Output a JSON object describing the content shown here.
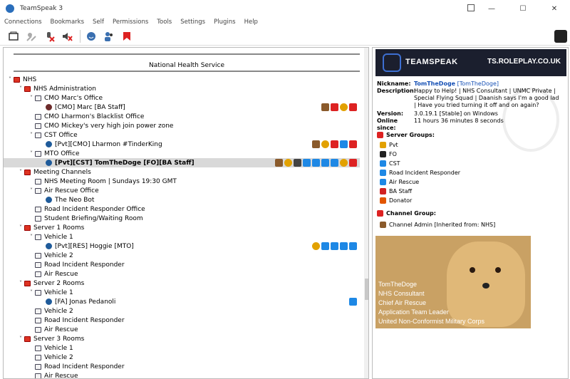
{
  "window": {
    "title": "TeamSpeak 3"
  },
  "menu": [
    "Connections",
    "Bookmarks",
    "Self",
    "Permissions",
    "Tools",
    "Settings",
    "Plugins",
    "Help"
  ],
  "toolbar": {
    "icons": [
      "connect-icon",
      "disconnect-icon",
      "mute-mic-icon",
      "mute-speaker-icon",
      "away-icon",
      "contacts-icon",
      "bookmarks-icon"
    ]
  },
  "tree": {
    "header": "National Health Service",
    "rows": [
      {
        "indent": 0,
        "arrow": "v",
        "type": "server",
        "label": "NHS"
      },
      {
        "indent": 1,
        "arrow": "v",
        "type": "channel-red",
        "label": "NHS Administration"
      },
      {
        "indent": 2,
        "arrow": "v",
        "type": "channel",
        "label": "CMO Marc's Office"
      },
      {
        "indent": 3,
        "arrow": "",
        "type": "user-muted",
        "label": "[CMO] Marc [BA Staff]",
        "badges": [
          "brown",
          "red",
          "gold",
          "red"
        ]
      },
      {
        "indent": 2,
        "arrow": "",
        "type": "channel",
        "label": "CMO Lharmon's Blacklist Office"
      },
      {
        "indent": 2,
        "arrow": "",
        "type": "channel",
        "label": "CMO Mickey's very high join power zone"
      },
      {
        "indent": 2,
        "arrow": "v",
        "type": "channel",
        "label": "CST Office"
      },
      {
        "indent": 3,
        "arrow": "",
        "type": "user",
        "label": "[Pvt][CMO] Lharmon #TinderKing",
        "badges": [
          "brown",
          "gold",
          "red",
          "blue",
          "red"
        ]
      },
      {
        "indent": 2,
        "arrow": "v",
        "type": "channel",
        "label": "MTO Office"
      },
      {
        "indent": 3,
        "arrow": "",
        "type": "user",
        "label": "[Pvt][CST] TomTheDoge [FO][BA Staff]",
        "selected": true,
        "badges": [
          "brown",
          "gold",
          "dark",
          "blue",
          "blue",
          "blue",
          "blue",
          "gold",
          "red"
        ]
      },
      {
        "indent": 1,
        "arrow": "v",
        "type": "channel-red",
        "label": "Meeting Channels"
      },
      {
        "indent": 2,
        "arrow": "",
        "type": "channel",
        "label": "NHS Meeting Room | Sundays 19:30 GMT"
      },
      {
        "indent": 2,
        "arrow": "v",
        "type": "channel",
        "label": "Air Rescue Office"
      },
      {
        "indent": 3,
        "arrow": "",
        "type": "user",
        "label": "The Neo Bot"
      },
      {
        "indent": 2,
        "arrow": "",
        "type": "channel",
        "label": "Road Incident Responder Office"
      },
      {
        "indent": 2,
        "arrow": "",
        "type": "channel",
        "label": "Student Briefing/Waiting Room"
      },
      {
        "indent": 1,
        "arrow": "v",
        "type": "channel-red",
        "label": "Server 1 Rooms"
      },
      {
        "indent": 2,
        "arrow": "v",
        "type": "channel",
        "label": "Vehicle 1"
      },
      {
        "indent": 3,
        "arrow": "",
        "type": "user",
        "label": "[Pvt][RES] Hoggie [MTO]",
        "badges": [
          "gold",
          "blue",
          "blue",
          "blue",
          "blue"
        ]
      },
      {
        "indent": 2,
        "arrow": "",
        "type": "channel",
        "label": "Vehicle 2"
      },
      {
        "indent": 2,
        "arrow": "",
        "type": "channel",
        "label": "Road Incident Responder"
      },
      {
        "indent": 2,
        "arrow": "",
        "type": "channel",
        "label": "Air Rescue"
      },
      {
        "indent": 1,
        "arrow": "v",
        "type": "channel-red",
        "label": "Server 2 Rooms"
      },
      {
        "indent": 2,
        "arrow": "v",
        "type": "channel",
        "label": "Vehicle 1"
      },
      {
        "indent": 3,
        "arrow": "",
        "type": "user",
        "label": "[FA] Jonas Pedanoli",
        "badges": [
          "blue"
        ]
      },
      {
        "indent": 2,
        "arrow": "",
        "type": "channel",
        "label": "Vehicle 2"
      },
      {
        "indent": 2,
        "arrow": "",
        "type": "channel",
        "label": "Road Incident Responder"
      },
      {
        "indent": 2,
        "arrow": "",
        "type": "channel",
        "label": "Air Rescue"
      },
      {
        "indent": 1,
        "arrow": "v",
        "type": "channel-red",
        "label": "Server 3 Rooms"
      },
      {
        "indent": 2,
        "arrow": "",
        "type": "channel",
        "label": "Vehicle 1"
      },
      {
        "indent": 2,
        "arrow": "",
        "type": "channel",
        "label": "Vehicle 2"
      },
      {
        "indent": 2,
        "arrow": "",
        "type": "channel",
        "label": "Road Incident Responder"
      },
      {
        "indent": 2,
        "arrow": "",
        "type": "channel",
        "label": "Air Rescue"
      }
    ]
  },
  "banner": {
    "brand": "TEAMSPEAK",
    "host": "TS.ROLEPLAY.CO.UK"
  },
  "info": {
    "nickname_label": "Nickname:",
    "nickname": "TomTheDoge",
    "nickname_alt": "[TomTheDoge]",
    "description_label": "Description:",
    "description": "Happy to Help! | NHS Consultant | UNMC Private | Special Flying Squad | Daanish says I'm a good lad | Have you tried turning it off and on again?",
    "version_label": "Version:",
    "version": "3.0.19.1 [Stable] on Windows",
    "online_label": "Online since:",
    "online": "11 hours 36 minutes 8 seconds"
  },
  "server_groups": {
    "title": "Server Groups:",
    "items": [
      {
        "name": "Pvt",
        "color": "#e2a100"
      },
      {
        "name": "FO",
        "color": "#222222"
      },
      {
        "name": "CST",
        "color": "#1e88e5"
      },
      {
        "name": "Road Incident Responder",
        "color": "#1e88e5"
      },
      {
        "name": "Air Rescue",
        "color": "#1e88e5"
      },
      {
        "name": "BA Staff",
        "color": "#d22222"
      },
      {
        "name": "Donator",
        "color": "#e25500"
      }
    ]
  },
  "channel_group": {
    "title": "Channel Group:",
    "item": "Channel Admin [Inherited from: NHS]"
  },
  "avatar": {
    "lines": [
      "TomTheDoge",
      "NHS Consultant",
      "Chief Air Rescue",
      "Application Team Leader",
      "United Non-Conformist Military Corps"
    ]
  }
}
